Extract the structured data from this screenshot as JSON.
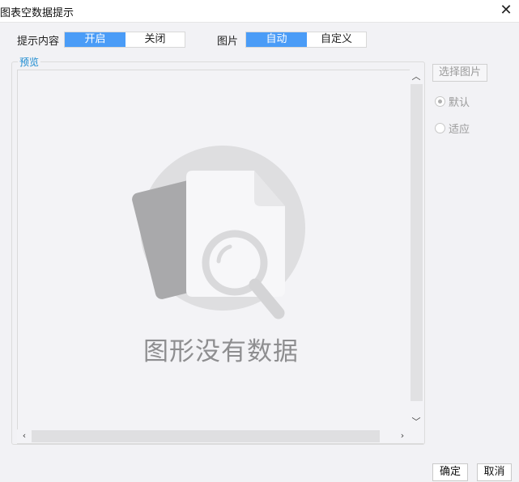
{
  "window": {
    "title": "图表空数据提示",
    "close_icon": "close-icon"
  },
  "content_row": {
    "label": "提示内容",
    "options": [
      "开启",
      "关闭"
    ],
    "selected": "开启"
  },
  "image_row": {
    "label": "图片",
    "options": [
      "自动",
      "自定义"
    ],
    "selected": "自动"
  },
  "preview": {
    "legend": "预览",
    "placeholder_text": "图形没有数据",
    "illustration_icon": "empty-data-magnifier-icon"
  },
  "side": {
    "select_image_button": "选择图片",
    "radios": [
      {
        "label": "默认",
        "checked": true
      },
      {
        "label": "适应",
        "checked": false
      }
    ]
  },
  "footer": {
    "ok_button": "确定",
    "cancel_button": "取消"
  },
  "colors": {
    "accent": "#4a9cf7",
    "legend": "#1a8ad0",
    "background": "#f2f2f5"
  }
}
